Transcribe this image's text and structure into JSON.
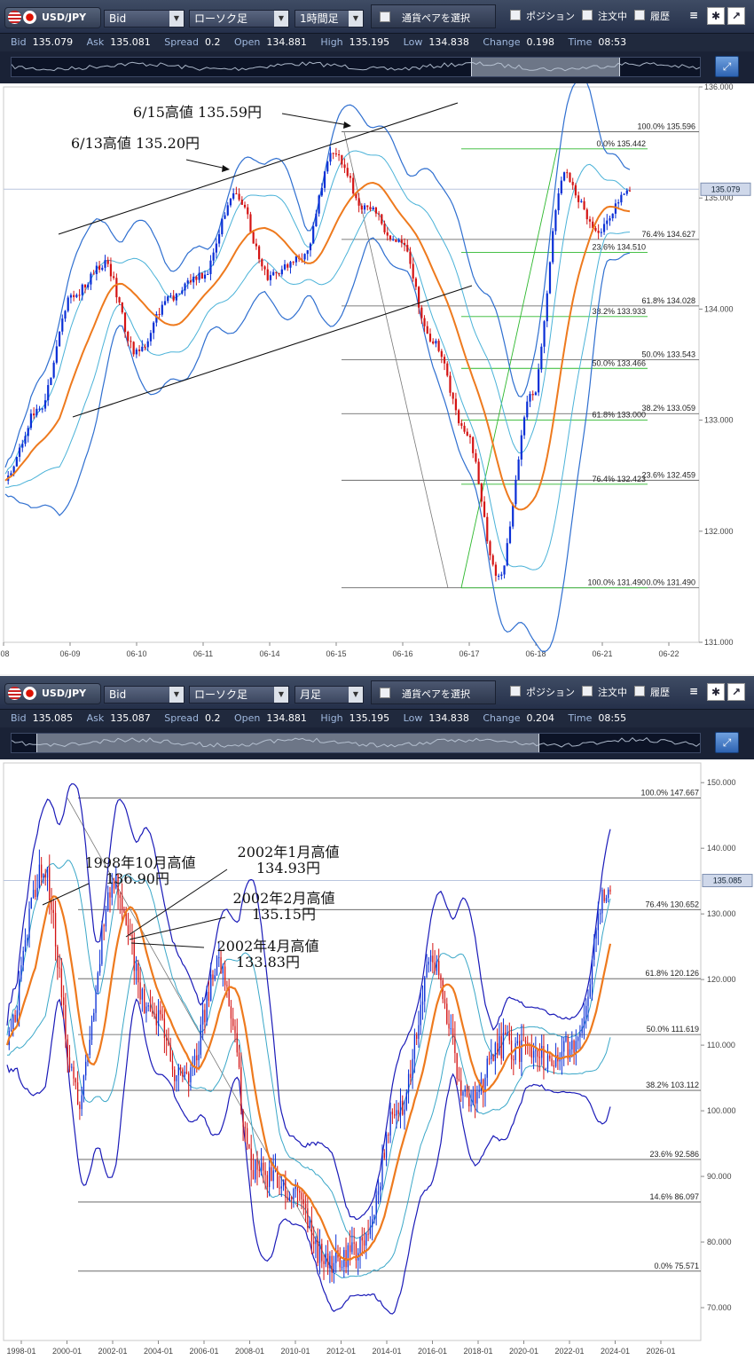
{
  "panels": [
    {
      "toolbar": {
        "pair": "USD/JPY",
        "price_type": "Bid",
        "chart_type": "ローソク足",
        "timeframe": "1時間足",
        "pair_select_label": "通貨ペアを選択",
        "position_label": "ポジション",
        "order_label": "注文中",
        "history_label": "履歴"
      },
      "quote": {
        "bid_label": "Bid",
        "bid": "135.079",
        "ask_label": "Ask",
        "ask": "135.081",
        "spread_label": "Spread",
        "spread": "0.2",
        "open_label": "Open",
        "open": "134.881",
        "high_label": "High",
        "high": "135.195",
        "low_label": "Low",
        "low": "134.838",
        "change_label": "Change",
        "change": "0.198",
        "time_label": "Time",
        "time": "08:53"
      },
      "price_tag": "135.079",
      "annotations": [
        "6/15高値 135.59円",
        "6/13高値 135.20円"
      ],
      "fib_retracement_labels": [
        "100.0%  135.596",
        "76.4%  134.627",
        "61.8%  134.028",
        "50.0%  133.543",
        "38.2%  133.059",
        "23.6%  132.459",
        "0.0%  131.490"
      ],
      "fib_rebound_labels": [
        "0.0%  135.442",
        "23.6%  134.510",
        "38.2%  133.933",
        "50.0%  133.466",
        "61.8%  133.000",
        "76.4%  132.423",
        "100.0%  131.490"
      ]
    },
    {
      "toolbar": {
        "pair": "USD/JPY",
        "price_type": "Bid",
        "chart_type": "ローソク足",
        "timeframe": "月足",
        "pair_select_label": "通貨ペアを選択",
        "position_label": "ポジション",
        "order_label": "注文中",
        "history_label": "履歴"
      },
      "quote": {
        "bid_label": "Bid",
        "bid": "135.085",
        "ask_label": "Ask",
        "ask": "135.087",
        "spread_label": "Spread",
        "spread": "0.2",
        "open_label": "Open",
        "open": "134.881",
        "high_label": "High",
        "high": "135.195",
        "low_label": "Low",
        "low": "134.838",
        "change_label": "Change",
        "change": "0.204",
        "time_label": "Time",
        "time": "08:55"
      },
      "price_tag": "135.085",
      "annotations": [
        "1998年10月高値",
        "136.90円",
        "2002年1月高値",
        "134.93円",
        "2002年2月高値",
        "135.15円",
        "2002年4月高値",
        "133.83円"
      ],
      "fib_labels": [
        "100.0%  147.667",
        "76.4%  130.652",
        "61.8%  120.126",
        "50.0%  111.619",
        "38.2%  103.112",
        "23.6%  92.586",
        "14.6%  86.097",
        "0.0%  75.571"
      ]
    }
  ],
  "colors": {
    "bull": "#0a2fd6",
    "bear": "#d41414",
    "ma": "#ee7a1e",
    "band_outer": "#2f6fd0",
    "band_inner": "#4ab2d8",
    "fib_green": "#2db82d",
    "monthly_band_outer": "#1a1ab8",
    "monthly_band_inner": "#3aa7c8"
  },
  "chart_data": [
    {
      "type": "line",
      "title": "",
      "timeframe": "1時間足",
      "x_ticks": [
        "-08",
        "06-09",
        "06-10",
        "06-11",
        "06-14",
        "06-15",
        "06-16",
        "06-17",
        "06-18",
        "06-21",
        "06-22"
      ],
      "y_ticks": [
        "136.000",
        "135.000",
        "134.000",
        "133.000",
        "132.000",
        "131.000"
      ],
      "ylim": [
        131.0,
        136.0
      ],
      "grid": true,
      "series": [
        {
          "x": [
            "06-08",
            "06-08",
            "06-09",
            "06-09",
            "06-10",
            "06-10",
            "06-11",
            "06-11",
            "06-14",
            "06-14",
            "06-15",
            "06-15",
            "06-16",
            "06-16",
            "06-17",
            "06-17",
            "06-18",
            "06-18",
            "06-21",
            "06-21"
          ],
          "values": [
            132.5,
            133.1,
            134.1,
            134.4,
            133.6,
            134.1,
            134.3,
            135.05,
            134.3,
            134.45,
            135.4,
            134.9,
            134.6,
            133.7,
            132.9,
            131.6,
            133.2,
            135.2,
            134.7,
            135.1
          ]
        }
      ]
    },
    {
      "type": "line",
      "title": "",
      "timeframe": "月足",
      "x_ticks": [
        "1998-01",
        "2000-01",
        "2002-01",
        "2004-01",
        "2006-01",
        "2008-01",
        "2010-01",
        "2012-01",
        "2014-01",
        "2016-01",
        "2018-01",
        "2020-01",
        "2022-01",
        "2024-01",
        "2026-01"
      ],
      "y_ticks": [
        "150.000",
        "140.000",
        "130.000",
        "120.000",
        "110.000",
        "100.000",
        "90.000",
        "80.000",
        "70.000"
      ],
      "ylim": [
        65.0,
        153.0
      ],
      "grid": true,
      "series": [
        {
          "x": [
            "1997-01",
            "1998-10",
            "1999-12",
            "2002-02",
            "2003-06",
            "2005-01",
            "2007-06",
            "2008-12",
            "2010-06",
            "2011-10",
            "2012-10",
            "2013-06",
            "2015-06",
            "2016-09",
            "2018-06",
            "2020-03",
            "2021-06",
            "2022-06"
          ],
          "values": [
            112,
            137,
            102,
            135,
            116,
            104,
            122,
            91,
            88,
            77,
            79,
            100,
            122,
            101,
            110,
            108,
            110,
            135
          ]
        }
      ]
    }
  ]
}
